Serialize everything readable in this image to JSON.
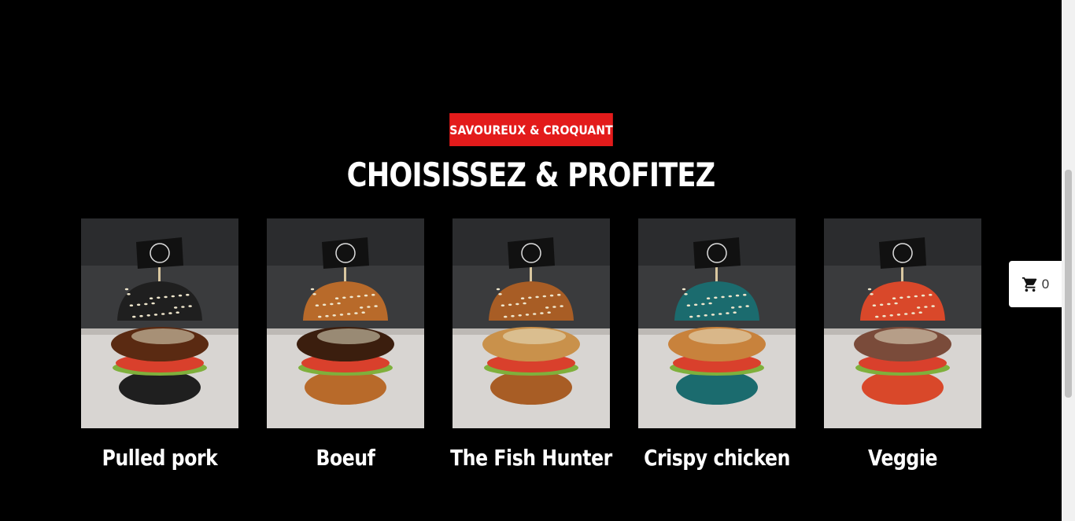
{
  "section": {
    "badge": "SAVOUREUX & CROQUANT",
    "title": "CHOISISSEZ & PROFITEZ"
  },
  "products": [
    {
      "name": "Pulled pork",
      "bun_color": "#1f1f1f",
      "accent": "#5a2a12"
    },
    {
      "name": "Boeuf",
      "bun_color": "#b86a2a",
      "accent": "#3b1e0e"
    },
    {
      "name": "The Fish Hunter",
      "bun_color": "#a85d25",
      "accent": "#c9914b"
    },
    {
      "name": "Crispy chicken",
      "bun_color": "#1b6b6e",
      "accent": "#c8823c"
    },
    {
      "name": "Veggie",
      "bun_color": "#d9482a",
      "accent": "#7a4b3a"
    }
  ],
  "cart": {
    "count": "0",
    "icon": "cart-icon"
  },
  "colors": {
    "accent": "#e31b1b",
    "background": "#000000"
  }
}
